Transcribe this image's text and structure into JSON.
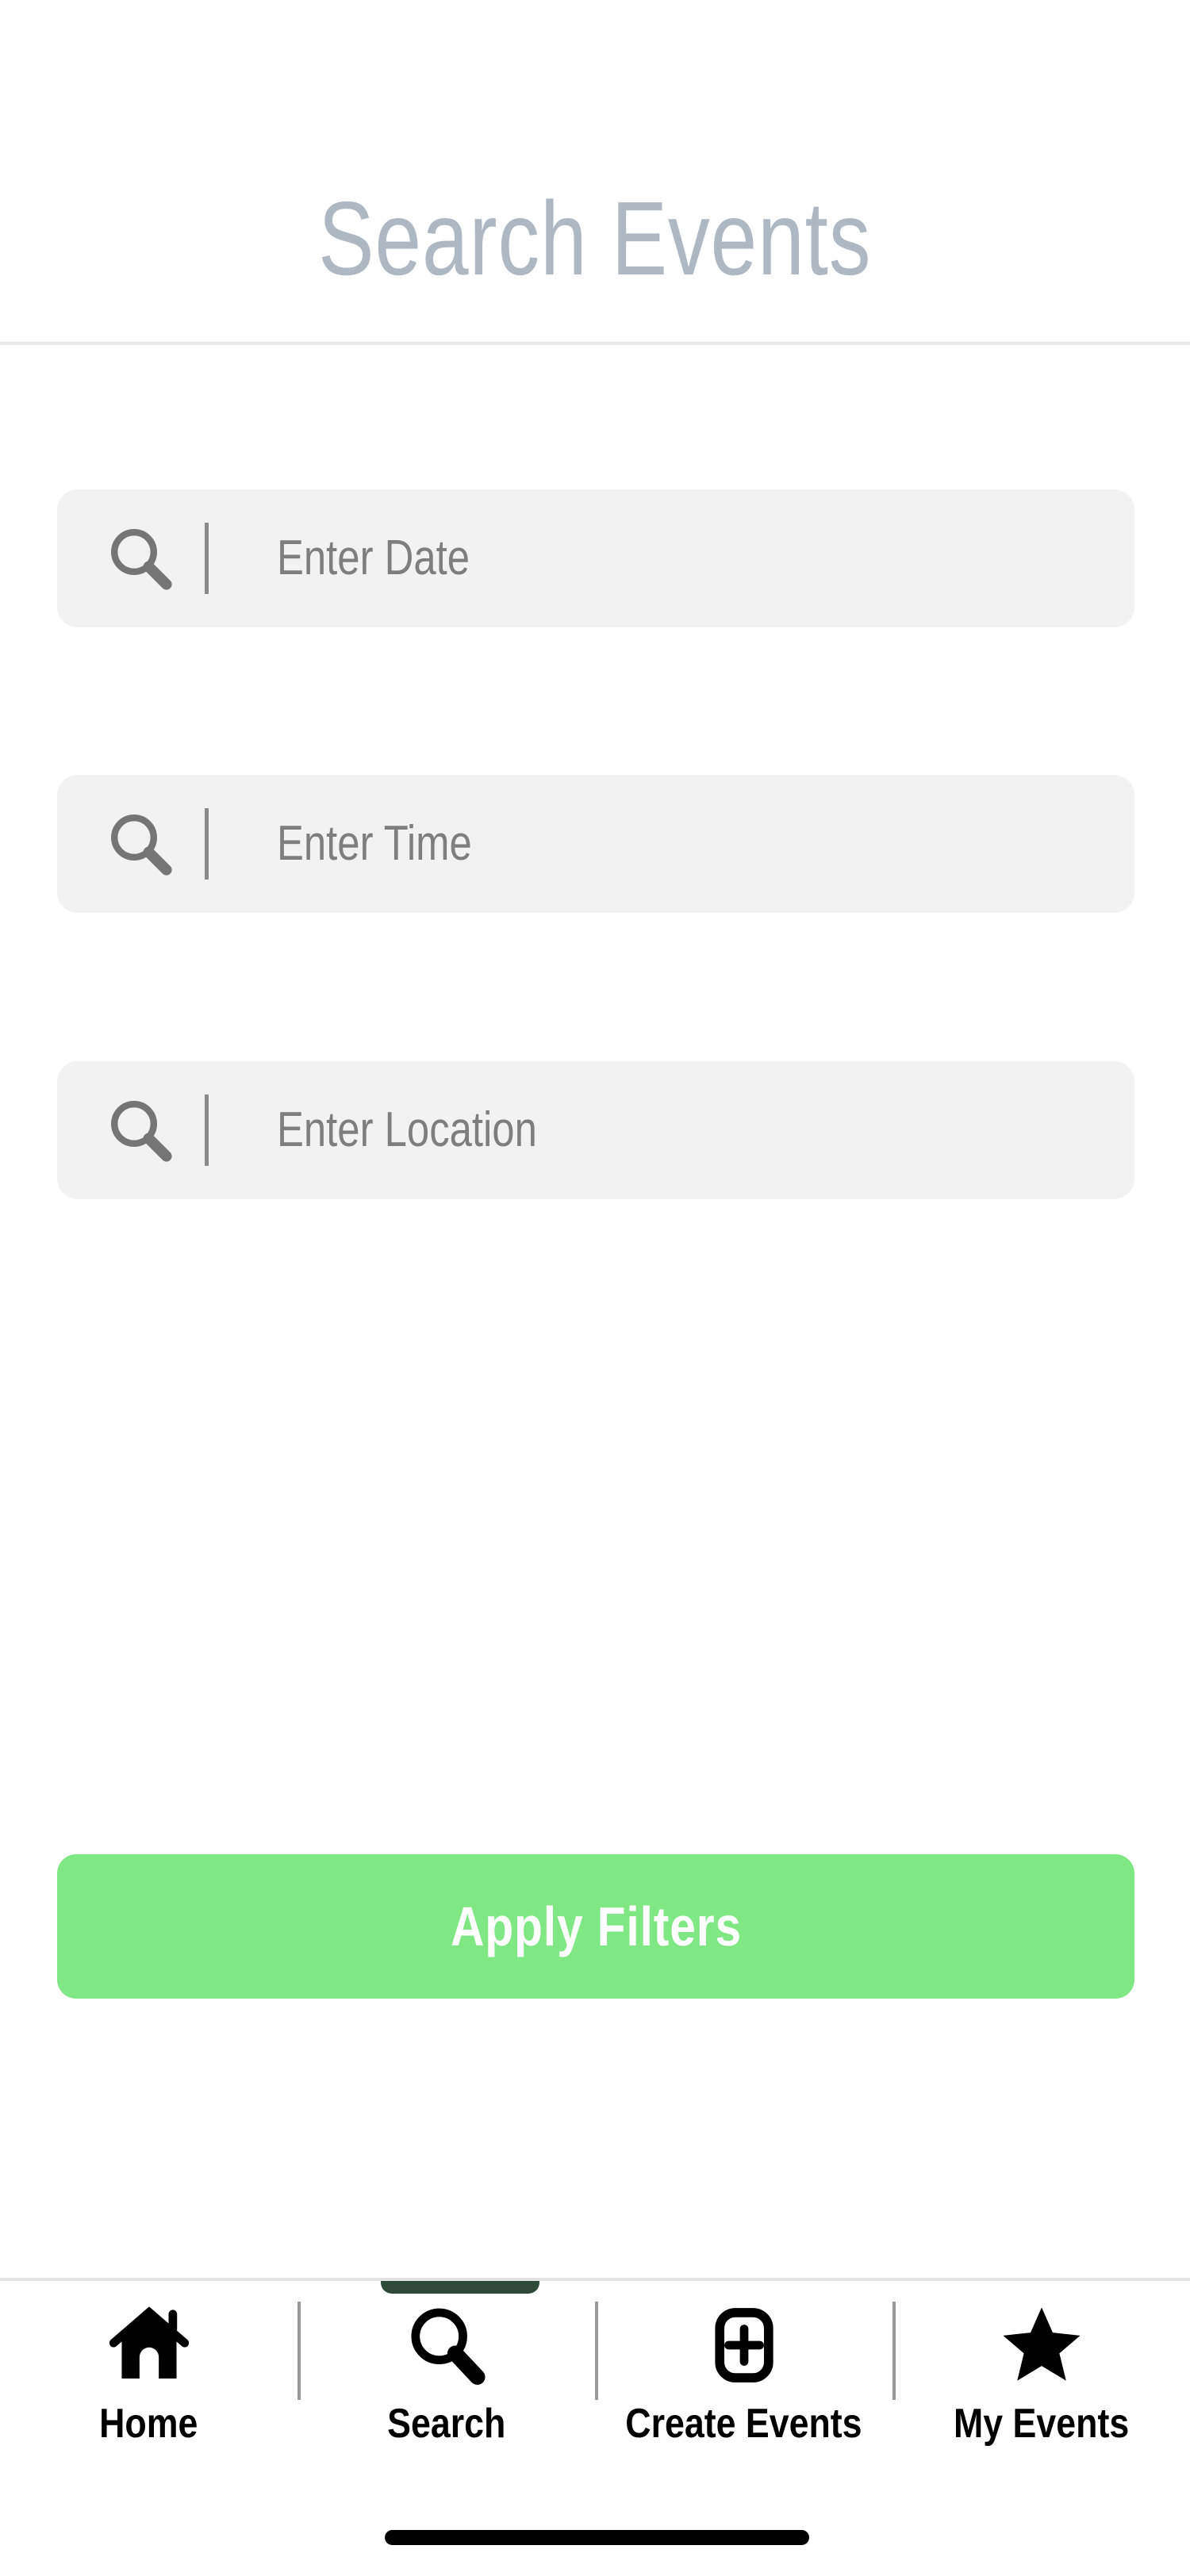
{
  "header": {
    "title": "Search Events"
  },
  "colors": {
    "title": "#aeb8c2",
    "field_background": "#f2f2f2",
    "field_text": "#7e7e7e",
    "accent_green": "#7fe884",
    "active_indicator": "#2f4a39",
    "divider": "#e8e8ea"
  },
  "filters": {
    "fields": [
      {
        "name": "date",
        "placeholder": "Enter Date",
        "value": "",
        "icon": "search-icon"
      },
      {
        "name": "time",
        "placeholder": "Enter Time",
        "value": "",
        "icon": "search-icon"
      },
      {
        "name": "location",
        "placeholder": "Enter Location",
        "value": "",
        "icon": "search-icon"
      }
    ],
    "apply_label": "Apply Filters"
  },
  "bottom_nav": {
    "active": "Search",
    "items": [
      {
        "label": "Home",
        "icon": "home-icon",
        "active": false
      },
      {
        "label": "Search",
        "icon": "search-icon",
        "active": true
      },
      {
        "label": "Create Events",
        "icon": "plus-square-icon",
        "active": false
      },
      {
        "label": "My Events",
        "icon": "star-icon",
        "active": false
      }
    ]
  }
}
